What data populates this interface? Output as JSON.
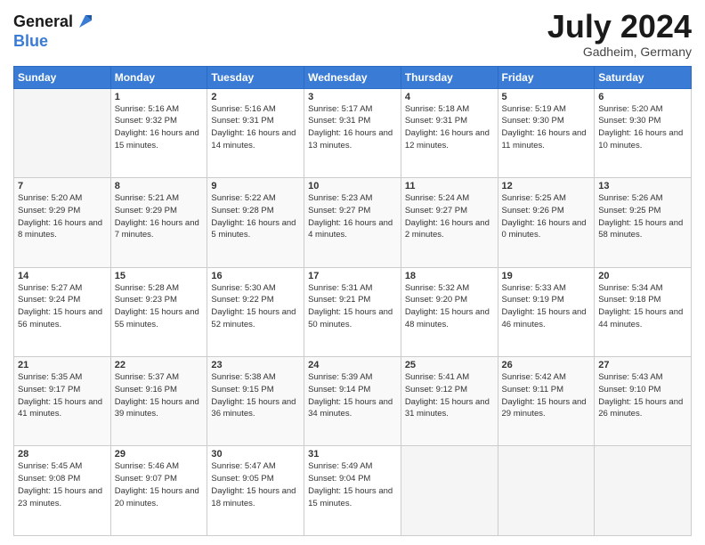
{
  "header": {
    "logo_line1": "General",
    "logo_line2": "Blue",
    "month": "July 2024",
    "location": "Gadheim, Germany"
  },
  "weekdays": [
    "Sunday",
    "Monday",
    "Tuesday",
    "Wednesday",
    "Thursday",
    "Friday",
    "Saturday"
  ],
  "weeks": [
    [
      {
        "day": "",
        "sunrise": "",
        "sunset": "",
        "daylight": ""
      },
      {
        "day": "1",
        "sunrise": "5:16 AM",
        "sunset": "9:32 PM",
        "daylight": "16 hours and 15 minutes."
      },
      {
        "day": "2",
        "sunrise": "5:16 AM",
        "sunset": "9:31 PM",
        "daylight": "16 hours and 14 minutes."
      },
      {
        "day": "3",
        "sunrise": "5:17 AM",
        "sunset": "9:31 PM",
        "daylight": "16 hours and 13 minutes."
      },
      {
        "day": "4",
        "sunrise": "5:18 AM",
        "sunset": "9:31 PM",
        "daylight": "16 hours and 12 minutes."
      },
      {
        "day": "5",
        "sunrise": "5:19 AM",
        "sunset": "9:30 PM",
        "daylight": "16 hours and 11 minutes."
      },
      {
        "day": "6",
        "sunrise": "5:20 AM",
        "sunset": "9:30 PM",
        "daylight": "16 hours and 10 minutes."
      }
    ],
    [
      {
        "day": "7",
        "sunrise": "5:20 AM",
        "sunset": "9:29 PM",
        "daylight": "16 hours and 8 minutes."
      },
      {
        "day": "8",
        "sunrise": "5:21 AM",
        "sunset": "9:29 PM",
        "daylight": "16 hours and 7 minutes."
      },
      {
        "day": "9",
        "sunrise": "5:22 AM",
        "sunset": "9:28 PM",
        "daylight": "16 hours and 5 minutes."
      },
      {
        "day": "10",
        "sunrise": "5:23 AM",
        "sunset": "9:27 PM",
        "daylight": "16 hours and 4 minutes."
      },
      {
        "day": "11",
        "sunrise": "5:24 AM",
        "sunset": "9:27 PM",
        "daylight": "16 hours and 2 minutes."
      },
      {
        "day": "12",
        "sunrise": "5:25 AM",
        "sunset": "9:26 PM",
        "daylight": "16 hours and 0 minutes."
      },
      {
        "day": "13",
        "sunrise": "5:26 AM",
        "sunset": "9:25 PM",
        "daylight": "15 hours and 58 minutes."
      }
    ],
    [
      {
        "day": "14",
        "sunrise": "5:27 AM",
        "sunset": "9:24 PM",
        "daylight": "15 hours and 56 minutes."
      },
      {
        "day": "15",
        "sunrise": "5:28 AM",
        "sunset": "9:23 PM",
        "daylight": "15 hours and 55 minutes."
      },
      {
        "day": "16",
        "sunrise": "5:30 AM",
        "sunset": "9:22 PM",
        "daylight": "15 hours and 52 minutes."
      },
      {
        "day": "17",
        "sunrise": "5:31 AM",
        "sunset": "9:21 PM",
        "daylight": "15 hours and 50 minutes."
      },
      {
        "day": "18",
        "sunrise": "5:32 AM",
        "sunset": "9:20 PM",
        "daylight": "15 hours and 48 minutes."
      },
      {
        "day": "19",
        "sunrise": "5:33 AM",
        "sunset": "9:19 PM",
        "daylight": "15 hours and 46 minutes."
      },
      {
        "day": "20",
        "sunrise": "5:34 AM",
        "sunset": "9:18 PM",
        "daylight": "15 hours and 44 minutes."
      }
    ],
    [
      {
        "day": "21",
        "sunrise": "5:35 AM",
        "sunset": "9:17 PM",
        "daylight": "15 hours and 41 minutes."
      },
      {
        "day": "22",
        "sunrise": "5:37 AM",
        "sunset": "9:16 PM",
        "daylight": "15 hours and 39 minutes."
      },
      {
        "day": "23",
        "sunrise": "5:38 AM",
        "sunset": "9:15 PM",
        "daylight": "15 hours and 36 minutes."
      },
      {
        "day": "24",
        "sunrise": "5:39 AM",
        "sunset": "9:14 PM",
        "daylight": "15 hours and 34 minutes."
      },
      {
        "day": "25",
        "sunrise": "5:41 AM",
        "sunset": "9:12 PM",
        "daylight": "15 hours and 31 minutes."
      },
      {
        "day": "26",
        "sunrise": "5:42 AM",
        "sunset": "9:11 PM",
        "daylight": "15 hours and 29 minutes."
      },
      {
        "day": "27",
        "sunrise": "5:43 AM",
        "sunset": "9:10 PM",
        "daylight": "15 hours and 26 minutes."
      }
    ],
    [
      {
        "day": "28",
        "sunrise": "5:45 AM",
        "sunset": "9:08 PM",
        "daylight": "15 hours and 23 minutes."
      },
      {
        "day": "29",
        "sunrise": "5:46 AM",
        "sunset": "9:07 PM",
        "daylight": "15 hours and 20 minutes."
      },
      {
        "day": "30",
        "sunrise": "5:47 AM",
        "sunset": "9:05 PM",
        "daylight": "15 hours and 18 minutes."
      },
      {
        "day": "31",
        "sunrise": "5:49 AM",
        "sunset": "9:04 PM",
        "daylight": "15 hours and 15 minutes."
      },
      {
        "day": "",
        "sunrise": "",
        "sunset": "",
        "daylight": ""
      },
      {
        "day": "",
        "sunrise": "",
        "sunset": "",
        "daylight": ""
      },
      {
        "day": "",
        "sunrise": "",
        "sunset": "",
        "daylight": ""
      }
    ]
  ],
  "labels": {
    "sunrise_prefix": "Sunrise: ",
    "sunset_prefix": "Sunset: ",
    "daylight_prefix": "Daylight: "
  }
}
